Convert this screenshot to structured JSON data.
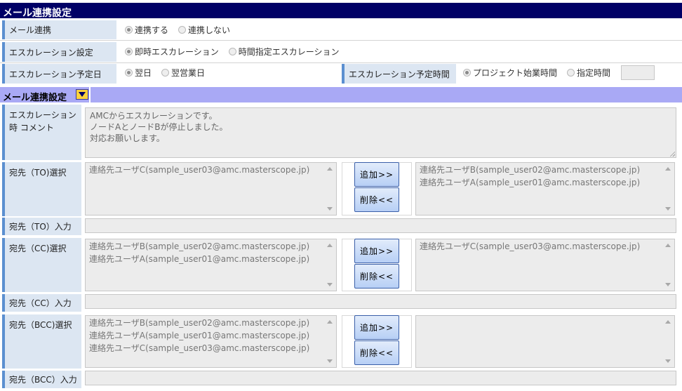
{
  "header": {
    "title": "メール連携設定"
  },
  "mail_link": {
    "label": "メール連携",
    "options": [
      "連携する",
      "連携しない"
    ],
    "selected": 0
  },
  "escalation": {
    "label": "エスカレーション設定",
    "options": [
      "即時エスカレーション",
      "時間指定エスカレーション"
    ],
    "selected": 0
  },
  "escalation_date": {
    "label": "エスカレーション予定日",
    "options": [
      "翌日",
      "翌営業日"
    ],
    "selected": 0
  },
  "escalation_time": {
    "label": "エスカレーション予定時間",
    "options": [
      "プロジェクト始業時間",
      "指定時間"
    ],
    "selected": 0,
    "time_value": ""
  },
  "section": {
    "title": "メール連携設定"
  },
  "comment": {
    "label_line1": "エスカレーション",
    "label_line2": "時 コメント",
    "value": "AMCからエスカレーションです。\nノードAとノードBが停止しました。\n対応お願いします。"
  },
  "buttons": {
    "add": "追加>>",
    "remove": "削除<<"
  },
  "to": {
    "select_label": "宛先（TO)選択",
    "input_label": "宛先（TO）入力",
    "available": [
      "連絡先ユーザC(sample_user03@amc.masterscope.jp)"
    ],
    "selected": [
      "連絡先ユーザB(sample_user02@amc.masterscope.jp)",
      "連絡先ユーザA(sample_user01@amc.masterscope.jp)"
    ],
    "input_value": ""
  },
  "cc": {
    "select_label": "宛先（CC)選択",
    "input_label": "宛先（CC）入力",
    "available": [
      "連絡先ユーザB(sample_user02@amc.masterscope.jp)",
      "連絡先ユーザA(sample_user01@amc.masterscope.jp)"
    ],
    "selected": [
      "連絡先ユーザC(sample_user03@amc.masterscope.jp)"
    ],
    "input_value": ""
  },
  "bcc": {
    "select_label": "宛先（BCC)選択",
    "input_label": "宛先（BCC）入力",
    "available": [
      "連絡先ユーザB(sample_user02@amc.masterscope.jp)",
      "連絡先ユーザA(sample_user01@amc.masterscope.jp)",
      "連絡先ユーザC(sample_user03@amc.masterscope.jp)"
    ],
    "selected": [],
    "input_value": ""
  }
}
